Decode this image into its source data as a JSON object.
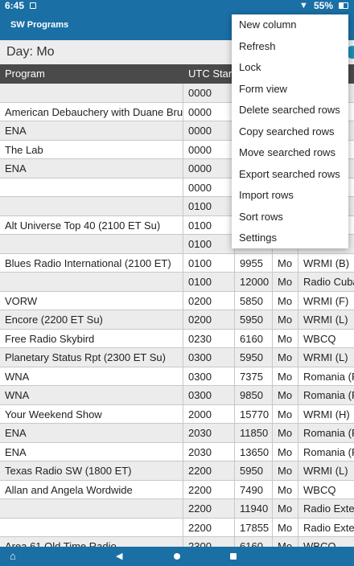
{
  "status_bar": {
    "time": "6:45",
    "battery": "55%",
    "wifi_icon": "wifi-icon"
  },
  "app_bar": {
    "title": "SW Programs"
  },
  "day_bar": {
    "label": "Day: Mo"
  },
  "table": {
    "headers": [
      "Program",
      "UTC Start",
      "",
      "",
      ""
    ],
    "rows": [
      [
        "",
        "0000",
        "",
        "",
        ""
      ],
      [
        "American Debauchery with Duane Bruce",
        "0000",
        "",
        "",
        ""
      ],
      [
        "ENA",
        "0000",
        "",
        "",
        ""
      ],
      [
        "The Lab",
        "0000",
        "",
        "",
        ""
      ],
      [
        "ENA",
        "0000",
        "",
        "",
        ""
      ],
      [
        "",
        "0000",
        "",
        "",
        ""
      ],
      [
        "",
        "0100",
        "",
        "",
        ""
      ],
      [
        "Alt Universe Top 40 (2100 ET Su)",
        "0100",
        "",
        "",
        ""
      ],
      [
        "",
        "0100",
        "",
        "",
        ""
      ],
      [
        "Blues Radio International (2100 ET)",
        "0100",
        "9955",
        "Mo",
        "WRMI (B)"
      ],
      [
        "",
        "0100",
        "12000",
        "Mo",
        "Radio Cuba"
      ],
      [
        "VORW",
        "0200",
        "5850",
        "Mo",
        "WRMI (F)"
      ],
      [
        "Encore (2200 ET Su)",
        "0200",
        "5950",
        "Mo",
        "WRMI (L)"
      ],
      [
        "Free Radio Skybird",
        "0230",
        "6160",
        "Mo",
        "WBCQ"
      ],
      [
        "Planetary Status Rpt (2300 ET Su)",
        "0300",
        "5950",
        "Mo",
        "WRMI (L)"
      ],
      [
        "WNA",
        "0300",
        "7375",
        "Mo",
        "Romania (R"
      ],
      [
        "WNA",
        "0300",
        "9850",
        "Mo",
        "Romania (R"
      ],
      [
        "Your Weekend Show",
        "2000",
        "15770",
        "Mo",
        "WRMI (H)"
      ],
      [
        "ENA",
        "2030",
        "11850",
        "Mo",
        "Romania (R"
      ],
      [
        "ENA",
        "2030",
        "13650",
        "Mo",
        "Romania (R"
      ],
      [
        "Texas Radio SW (1800 ET)",
        "2200",
        "5950",
        "Mo",
        "WRMI (L)"
      ],
      [
        "Allan and Angela Wordwide",
        "2200",
        "7490",
        "Mo",
        "WBCQ"
      ],
      [
        "",
        "2200",
        "11940",
        "Mo",
        "Radio Exteri"
      ],
      [
        "",
        "2200",
        "17855",
        "Mo",
        "Radio Exteri"
      ],
      [
        "Area 61 Old Time Radio",
        "2300",
        "6160",
        "Mo",
        "WBCQ"
      ]
    ]
  },
  "menu": {
    "items": [
      "New column",
      "Refresh",
      "Lock",
      "Form view",
      "Delete searched rows",
      "Copy searched rows",
      "Move searched rows",
      "Export searched rows",
      "Import rows",
      "Sort rows",
      "Settings"
    ]
  },
  "colors": {
    "primary": "#1a6fa5",
    "header": "#4a4a4a",
    "alt_row": "#ececec",
    "accent": "#1a8fb7"
  }
}
